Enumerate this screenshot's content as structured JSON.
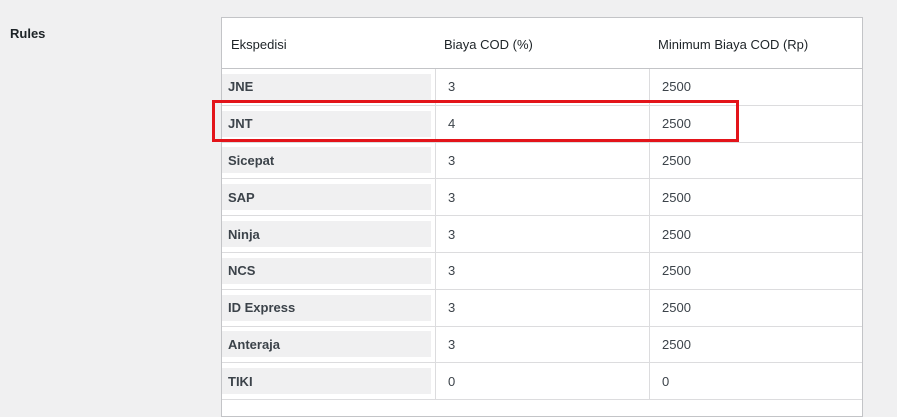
{
  "section_label": "Rules",
  "table": {
    "headers": [
      "Ekspedisi",
      "Biaya COD (%)",
      "Minimum Biaya COD (Rp)"
    ],
    "rows": [
      {
        "name": "JNE",
        "fee": "3",
        "min": "2500"
      },
      {
        "name": "JNT",
        "fee": "4",
        "min": "2500"
      },
      {
        "name": "Sicepat",
        "fee": "3",
        "min": "2500"
      },
      {
        "name": "SAP",
        "fee": "3",
        "min": "2500"
      },
      {
        "name": "Ninja",
        "fee": "3",
        "min": "2500"
      },
      {
        "name": "NCS",
        "fee": "3",
        "min": "2500"
      },
      {
        "name": "ID Express",
        "fee": "3",
        "min": "2500"
      },
      {
        "name": "Anteraja",
        "fee": "3",
        "min": "2500"
      },
      {
        "name": "TIKI",
        "fee": "0",
        "min": "0"
      }
    ]
  },
  "colors": {
    "highlight": "#e3141a",
    "page_background": "#f0f0f1",
    "name_cell_background": "#f0f0f1"
  }
}
